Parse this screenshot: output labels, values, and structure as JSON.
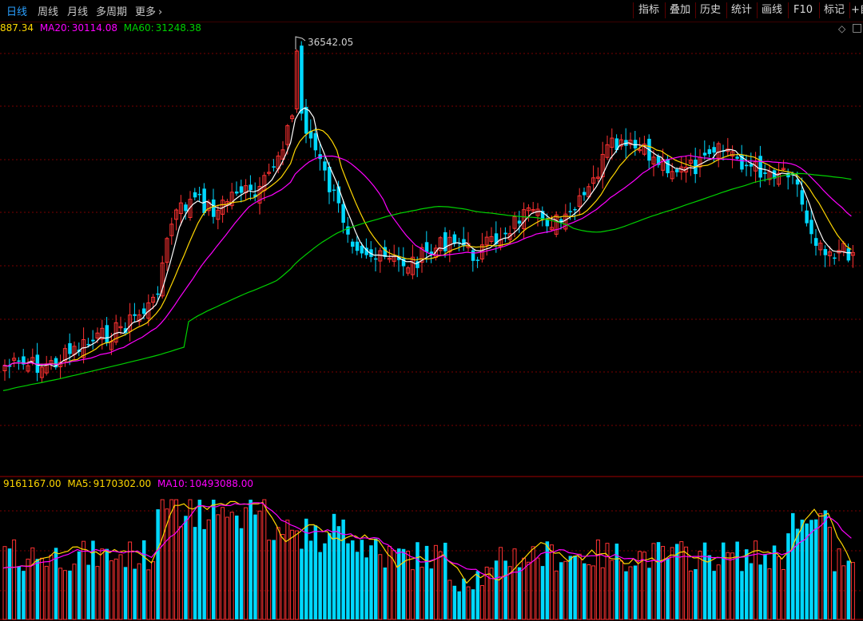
{
  "toolbar": {
    "tabs": [
      {
        "label": "日线",
        "active": true
      },
      {
        "label": "周线",
        "active": false
      },
      {
        "label": "月线",
        "active": false
      },
      {
        "label": "多周期",
        "active": false
      },
      {
        "label": "更多",
        "active": false
      }
    ],
    "more_chevron": "chevron-right-icon",
    "right_buttons": [
      "指标",
      "叠加",
      "历史",
      "统计",
      "画线",
      "F10",
      "标记",
      "+自"
    ]
  },
  "main_legend": {
    "ma_short": "887.34",
    "ma20_label": "MA20:",
    "ma20_value": "30114.08",
    "ma60_label": "MA60:",
    "ma60_value": "31248.38",
    "collapse_icon": "diamond-icon"
  },
  "annotation": {
    "peak_label": "36542.05"
  },
  "volume_legend": {
    "vol_value": "9161167.00",
    "ma5_label": "MA5:",
    "ma5_value": "9170302.00",
    "ma10_label": "MA10:",
    "ma10_value": "10493088.00"
  },
  "colors": {
    "up": "#ff3232",
    "down": "#00d8ff",
    "ma5": "#ffffff",
    "ma10": "#ffd700",
    "ma20": "#ff00ff",
    "ma60": "#00d000",
    "active_tab": "#2aa0ff",
    "grid": "#7a0000"
  },
  "chart_data": {
    "type": "candlestick",
    "panels": [
      "price",
      "volume"
    ],
    "price_peak": 36542.05,
    "ma_series": [
      "MA5",
      "MA10",
      "MA20",
      "MA60"
    ],
    "volume_ma_series": [
      "MA5",
      "MA10"
    ],
    "grid": true
  }
}
